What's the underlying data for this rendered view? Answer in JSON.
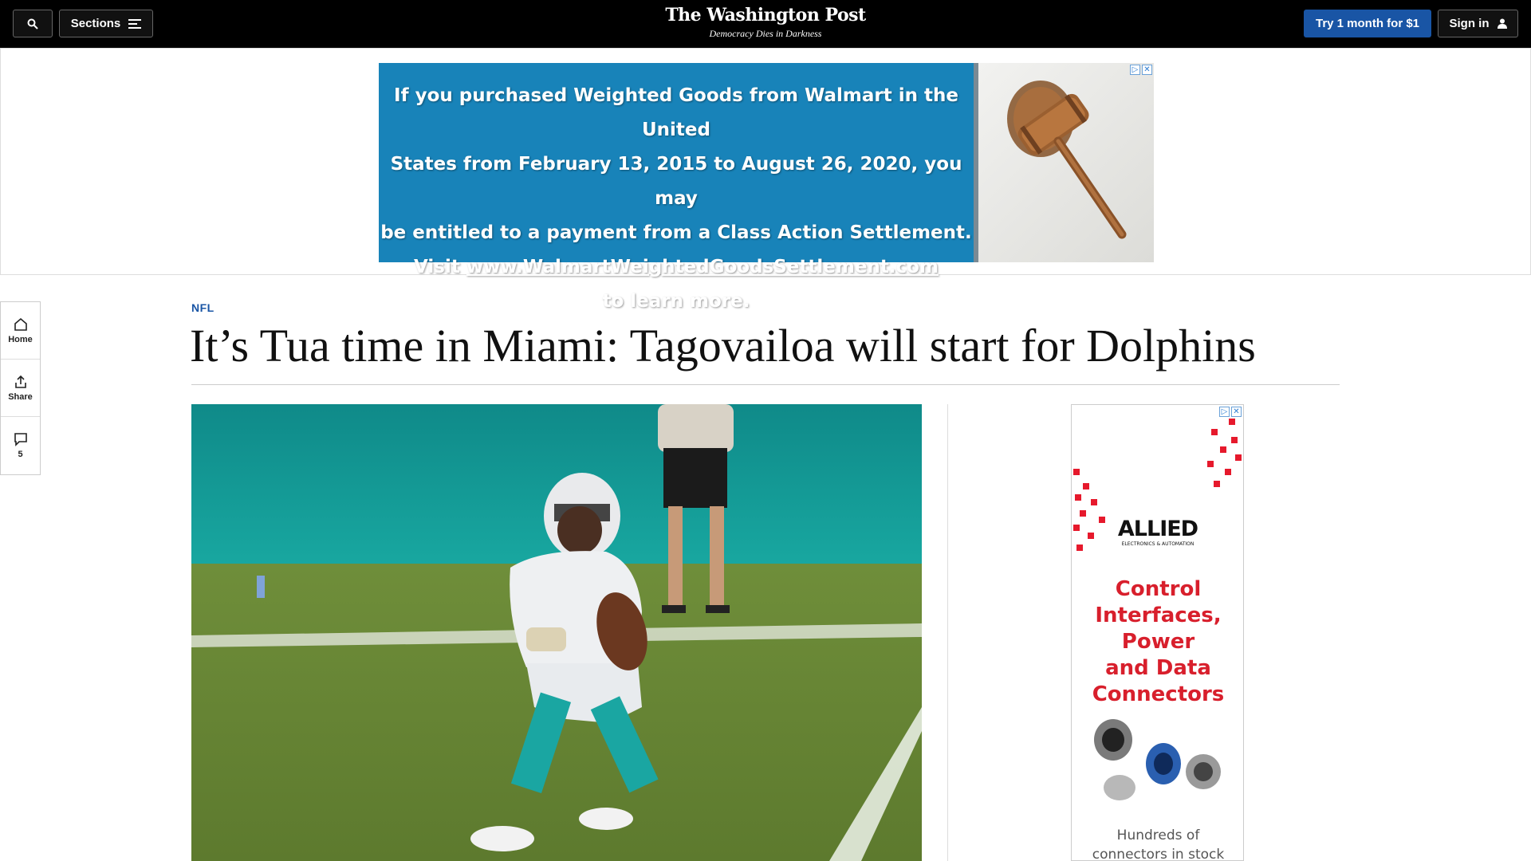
{
  "header": {
    "sections_label": "Sections",
    "masthead_title": "The Washington Post",
    "masthead_tagline": "Democracy Dies in Darkness",
    "trial_button": "Try 1 month for $1",
    "signin_button": "Sign in"
  },
  "top_ad": {
    "line1": "If you purchased Weighted Goods from Walmart in the United",
    "line2": "States from February 13, 2015 to August 26, 2020, you may",
    "line3": "be entitled to a payment from a Class Action Settlement.",
    "line4_prefix": "Visit ",
    "line4_url": "www.WalmartWeightedGoodsSettlement.com",
    "line5": "to learn more."
  },
  "rail": {
    "home_label": "Home",
    "share_label": "Share",
    "comments_count": "5"
  },
  "article": {
    "kicker": "NFL",
    "headline": "It’s Tua time in Miami: Tagovailoa will start for Dolphins"
  },
  "side_ad": {
    "brand": "ALLIED",
    "brand_sub": "ELECTRONICS & AUTOMATION",
    "pitch_lines": [
      "Control",
      "Interfaces,",
      "Power",
      "and Data",
      "Connectors"
    ],
    "footer_line1": "Hundreds of",
    "footer_line2": "connectors in stock"
  },
  "colors": {
    "accent_blue": "#1955a5",
    "ad_blue": "#1883b9",
    "ad_red": "#d81f2c"
  }
}
